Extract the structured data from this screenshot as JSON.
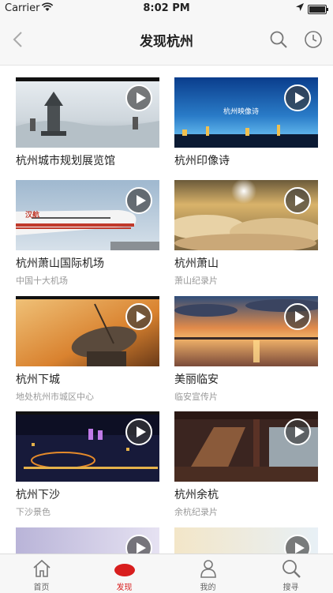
{
  "status_bar": {
    "carrier": "Carrier",
    "time": "8:02 PM"
  },
  "nav": {
    "title": "发现杭州"
  },
  "videos": [
    {
      "title": "杭州城市规划展览馆",
      "subtitle": ""
    },
    {
      "title": "杭州印像诗",
      "subtitle": ""
    },
    {
      "title": "杭州萧山国际机场",
      "subtitle": "中国十大机场"
    },
    {
      "title": "杭州萧山",
      "subtitle": "萧山纪录片"
    },
    {
      "title": "杭州下城",
      "subtitle": "地处杭州市城区中心"
    },
    {
      "title": "美丽临安",
      "subtitle": "临安宣传片"
    },
    {
      "title": "杭州下沙",
      "subtitle": "下沙景色"
    },
    {
      "title": "杭州余杭",
      "subtitle": "余杭纪录片"
    }
  ],
  "thumbnail_text": {
    "poem_title": "杭州映像诗",
    "plane_text": "汉航"
  },
  "tabs": [
    {
      "label": "首页",
      "icon": "home-icon"
    },
    {
      "label": "发现",
      "icon": "discover-icon",
      "active": true
    },
    {
      "label": "我的",
      "icon": "profile-icon"
    },
    {
      "label": "搜寻",
      "icon": "search-icon"
    }
  ],
  "colors": {
    "accent": "#d81e1e",
    "bar": "#f7f7f7"
  }
}
